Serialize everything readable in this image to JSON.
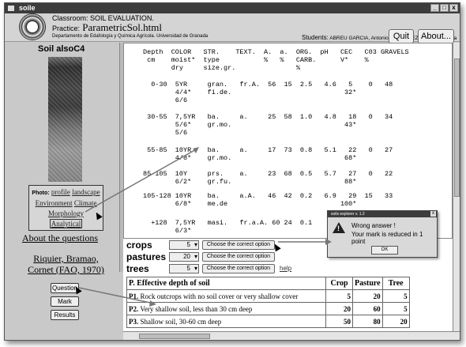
{
  "window": {
    "title": "soile",
    "controls": [
      "_",
      "□",
      "x"
    ]
  },
  "header": {
    "classroom": "Classroom: SOIL EVALUATION.",
    "practice_label": "Practice:",
    "practice_value": "ParametricSol.html",
    "department": "Departamento de Edafología y Química Agrícola. Universidad de Granada",
    "students_label": "Students:",
    "students_value": "ABREU GARCIA, Antonio; BLAZQUEZ BAYONA, Laura",
    "quit": "Quit",
    "about": "About..."
  },
  "sidebar": {
    "soil_title": "Soil alsoC4",
    "photo_label": "Photo:",
    "links": [
      "profile",
      "landscape",
      "Environment",
      "Climate",
      "Morphology",
      "Analytical"
    ],
    "about_questions": "About the questions",
    "reference": "Riquier, Bramao, Cornet (FAO, 1970)",
    "buttons": [
      "Question",
      "Mark",
      "Results"
    ]
  },
  "analysis": {
    "header_line1": "Depth  COLOR   STR.    TEXT.  A.  a.  ORG.  pH   CEC   C03 GRAVELS",
    "header_line2": " cm    moist*  type           %   %   CARB.      V*    %",
    "header_line3": "       dry     size.gr.               %",
    "rows": [
      {
        "l1": "  0-30  5YR     gran.   fr.A.  56  15  2.5   4.6   5    0   48",
        "l2": "        4/4*    fi.de.                            32*",
        "l3": "        6/6"
      },
      {
        "l1": " 30-55  7,5YR   ba.     a.     25  58  1.0   4.8   18   0   34",
        "l2": "        5/6*    gr.mo.                            43*",
        "l3": "        5/6"
      },
      {
        "l1": " 55-85  10YR    ba.     a.     17  73  0.8   5.1   22   0   27",
        "l2": "        4/8*    gr.mo.                            68*",
        "l3": ""
      },
      {
        "l1": "85-105  10Y     prs.    a.     23  68  0.5   5.7   27   0   22",
        "l2": "        6/2*    gr.fu.                            88*",
        "l3": ""
      },
      {
        "l1": "105-128 10YR    ba.     a.A.   46  42  0.2   6.9   29  15   33",
        "l2": "        6/8*    me.de                            100*",
        "l3": ""
      },
      {
        "l1": "  +128  7,5YR   masi.   fr.a.A. 60 24  0.1",
        "l2": "        6/3*",
        "l3": ""
      }
    ]
  },
  "questions": {
    "items": [
      {
        "label": "crops",
        "value": "5",
        "button": "Choose the correct option"
      },
      {
        "label": "pastures",
        "value": "20",
        "button": "Choose the correct option"
      },
      {
        "label": "trees",
        "value": "5",
        "button": "Choose the correct option"
      }
    ],
    "help": "help"
  },
  "table": {
    "headers": [
      "P. Effective depth of soil",
      "Crop",
      "Pasture",
      "Tree"
    ],
    "rows": [
      {
        "code": "P1.",
        "text": "Rock outcrops with no soil cover or very shallow cover",
        "crop": "5",
        "pasture": "20",
        "tree": "5"
      },
      {
        "code": "P2.",
        "text": "Very shallow soil, less than 30 cm deep",
        "crop": "20",
        "pasture": "60",
        "tree": "5"
      },
      {
        "code": "P3.",
        "text": "Shallow soil, 30-60 cm deep",
        "crop": "50",
        "pasture": "80",
        "tree": "20"
      }
    ]
  },
  "dialog": {
    "title": "soils explorer v. 1.2",
    "message1": "Wrong answer !",
    "message2": "Your mark is reduced in 1 point",
    "ok": "OK"
  }
}
